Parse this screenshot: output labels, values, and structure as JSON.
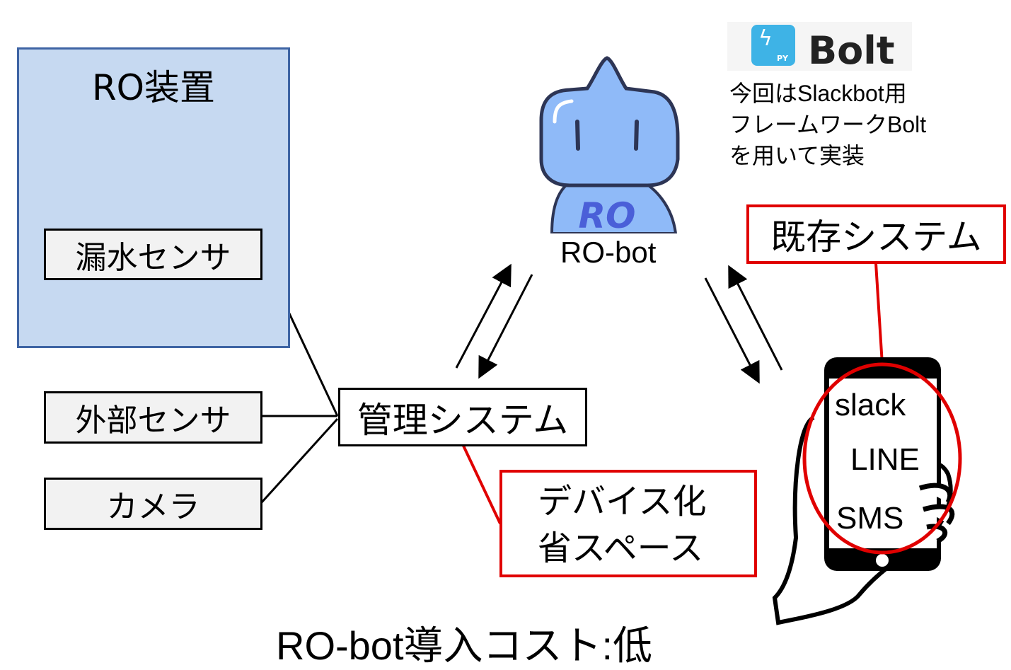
{
  "ro_device": {
    "title": "RO装置"
  },
  "sensors": [
    {
      "label": "漏水センサ"
    },
    {
      "label": "外部センサ"
    },
    {
      "label": "カメラ"
    }
  ],
  "management": {
    "label": "管理システム"
  },
  "benefit": {
    "line1": "デバイス化",
    "line2": "省スペース"
  },
  "robot": {
    "label": "RO-bot",
    "badge": "RO"
  },
  "bolt": {
    "logo_text": "Bolt",
    "logo_sub": "PY",
    "note": [
      "今回はSlackbot用",
      "フレームワークBolt",
      "を用いて実装"
    ]
  },
  "existing": {
    "label": "既存システム"
  },
  "phone_apps": [
    "slack",
    "LINE",
    "SMS"
  ],
  "footer": "RO-bot導入コスト:低",
  "colors": {
    "device_fill": "#c6d9f1",
    "device_border": "#3e64a4",
    "highlight": "#e00000",
    "robot": "#8fbaf8",
    "bolt": "#3eb3e6"
  }
}
